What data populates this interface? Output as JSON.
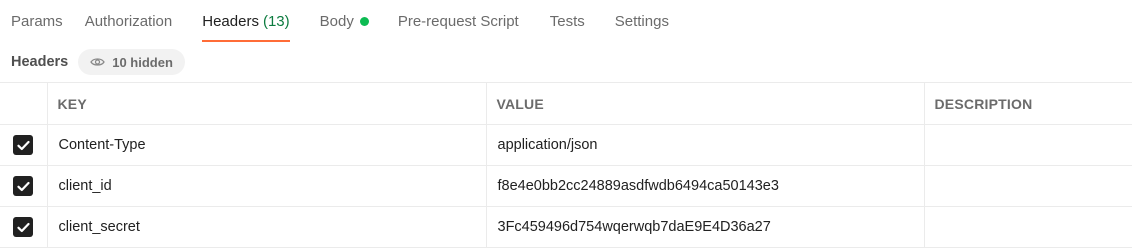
{
  "tabs": [
    {
      "label": "Params"
    },
    {
      "label": "Authorization"
    },
    {
      "label": "Headers",
      "count": "(13)"
    },
    {
      "label": "Body"
    },
    {
      "label": "Pre-request Script"
    },
    {
      "label": "Tests"
    },
    {
      "label": "Settings"
    }
  ],
  "headers_section": {
    "title": "Headers",
    "hidden_label": "10 hidden",
    "hidden_icon": "eye-icon"
  },
  "table": {
    "columns": [
      "KEY",
      "VALUE",
      "DESCRIPTION"
    ],
    "rows": [
      {
        "checked": true,
        "key": "Content-Type",
        "value": "application/json",
        "description": ""
      },
      {
        "checked": true,
        "key": "client_id",
        "value": "f8e4e0bb2cc24889asdfwdb6494ca50143e3",
        "description": ""
      },
      {
        "checked": true,
        "key": "client_secret",
        "value": "3Fc459496d754wqerwqb7daE9E4D36a27",
        "description": ""
      }
    ]
  },
  "colors": {
    "active_tab_underline": "#ff6c37",
    "count_text": "#0c7b3f",
    "body_indicator_dot": "#0cbb52"
  }
}
